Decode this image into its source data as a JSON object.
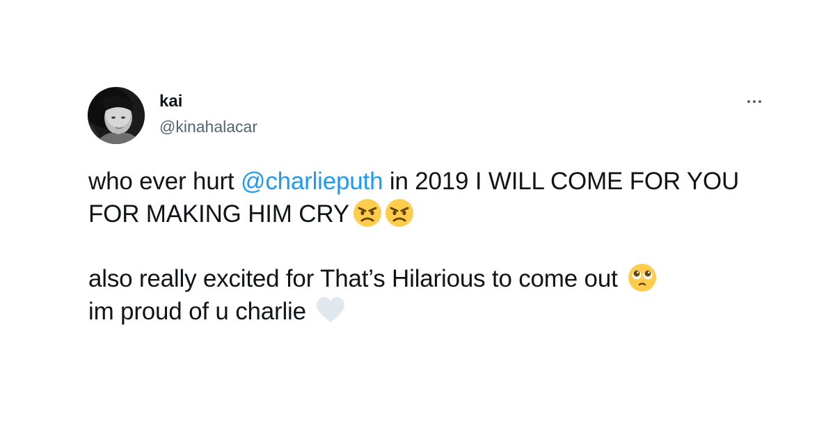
{
  "user": {
    "display_name": "kai",
    "handle": "@kinahalacar",
    "avatar_icon": "profile-photo"
  },
  "more_icon": "more-horizontal-icon",
  "tweet": {
    "line1_a": "who ever hurt ",
    "mention": "@charlieputh",
    "line1_b": " in 2019 I WILL COME FOR YOU FOR MAKING HIM CRY",
    "line2_a": "also really excited for That’s Hilarious to come out",
    "line2_b": "im proud of u charlie",
    "emojis": [
      "angry-face",
      "angry-face",
      "pleading-face",
      "white-heart"
    ]
  },
  "colors": {
    "mention": "#1d9bf0",
    "handle": "#536471",
    "text": "#0f1419",
    "emoji_face": "#ffcc4d",
    "heart": "#e1e8ed"
  }
}
